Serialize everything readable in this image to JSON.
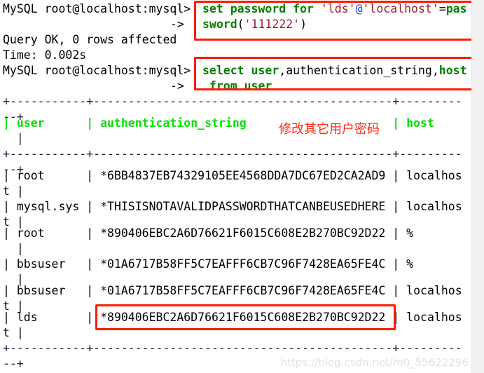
{
  "terminal": {
    "prompt": "MySQL root@localhost:mysql>",
    "continuation": "->",
    "statement_1": {
      "kw_set": "set password for ",
      "str_user": "'lds'",
      "at": "@",
      "str_host": "'localhost'",
      "eq": "=",
      "kw_pass_a": "pas",
      "kw_pass_b": "sword",
      "open_paren": "(",
      "str_pwd": "'111222'",
      "close_paren": ")"
    },
    "result_1": "Query OK, 0 rows affected",
    "timing_1": "Time: 0.002s",
    "statement_2": {
      "kw_select": "select user",
      "cols_plain": ",authentication_string,",
      "kw_host": "host",
      "kw_from": " from user"
    },
    "separator_main": "+-----------+-------------------------------------------+---------",
    "separator_wrap": "--+",
    "table": {
      "columns": [
        "user",
        "authentication_string",
        "host"
      ],
      "header_row_a": "| user      | authentication_string                     | host",
      "header_row_b": "  |",
      "rows": [
        {
          "line_a": "| root      | *6BB4837EB74329105EE4568DDA7DC67ED2CA2AD9 | localhos",
          "line_b": "t |",
          "user": "root",
          "authentication_string": "*6BB4837EB74329105EE4568DDA7DC67ED2CA2AD9",
          "host": "localhost"
        },
        {
          "line_a": "| mysql.sys | *THISISNOTAVALIDPASSWORDTHATCANBEUSEDHERE | localhos",
          "line_b": "t |",
          "user": "mysql.sys",
          "authentication_string": "*THISISNOTAVALIDPASSWORDTHATCANBEUSEDHERE",
          "host": "localhost"
        },
        {
          "line_a": "| root      | *890406EBC2A6D76621F6015C608E2B270BC92D22 | %",
          "line_b": "  |",
          "user": "root",
          "authentication_string": "*890406EBC2A6D76621F6015C608E2B270BC92D22",
          "host": "%"
        },
        {
          "line_a": "| bbsuser   | *01A6717B58FF5C7EAFFF6CB7C96F7428EA65FE4C | %",
          "line_b": "  |",
          "user": "bbsuser",
          "authentication_string": "*01A6717B58FF5C7EAFFF6CB7C96F7428EA65FE4C",
          "host": "%"
        },
        {
          "line_a": "| bbsuser   | *01A6717B58FF5C7EAFFF6CB7C96F7428EA65FE4C | localhos",
          "line_b": "t |",
          "user": "bbsuser",
          "authentication_string": "*01A6717B58FF5C7EAFFF6CB7C96F7428EA65FE4C",
          "host": "localhost"
        },
        {
          "line_a": "| lds       | *890406EBC2A6D76621F6015C608E2B270BC92D22 | localhos",
          "line_b": "t |",
          "user": "lds",
          "authentication_string": "*890406EBC2A6D76621F6015C608E2B270BC92D22",
          "host": "localhost"
        }
      ]
    }
  },
  "annotations": {
    "chinese_note": "修改其它用户密码",
    "box_color": "#ff1a00",
    "note_color": "#ff2a10"
  },
  "watermark": {
    "text": "https://blog.csdn.net/m0_55622296"
  }
}
